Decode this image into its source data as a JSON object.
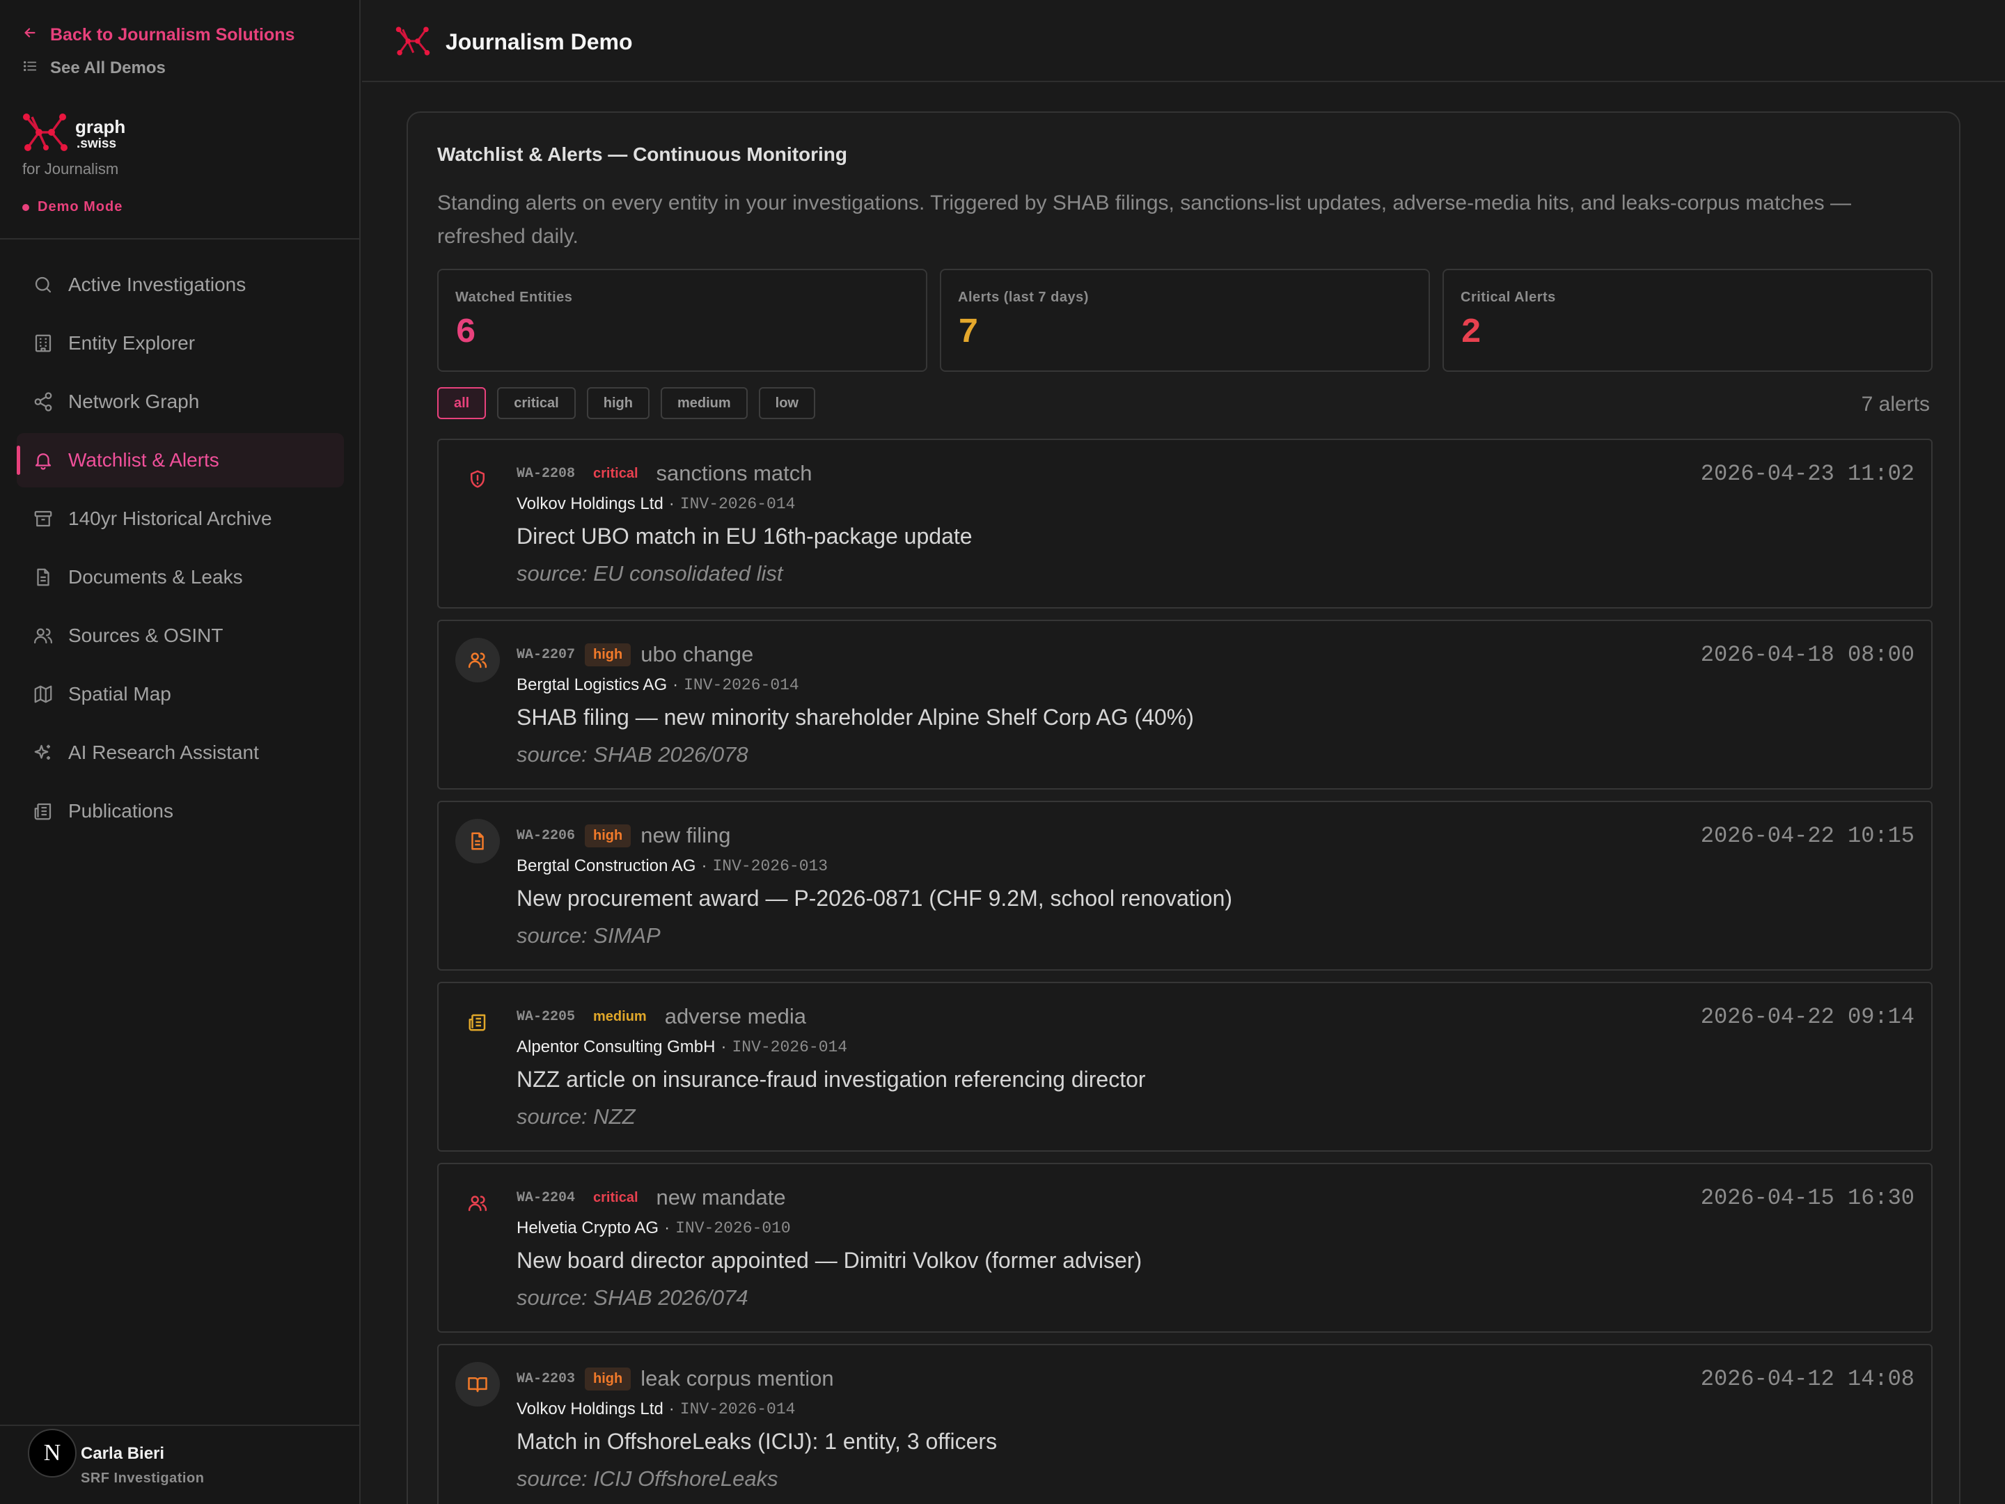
{
  "sidebar": {
    "back_label": "Back to Journalism Solutions",
    "see_all_label": "See All Demos",
    "brand_main": "graph",
    "brand_sub": ".swiss",
    "brand_for": "for Journalism",
    "demo_mode": "Demo Mode",
    "items": [
      {
        "label": "Active Investigations",
        "icon": "search-icon"
      },
      {
        "label": "Entity Explorer",
        "icon": "building-icon"
      },
      {
        "label": "Network Graph",
        "icon": "share-nodes-icon"
      },
      {
        "label": "Watchlist & Alerts",
        "icon": "bell-icon",
        "active": true
      },
      {
        "label": "140yr Historical Archive",
        "icon": "archive-box-icon"
      },
      {
        "label": "Documents & Leaks",
        "icon": "document-icon"
      },
      {
        "label": "Sources & OSINT",
        "icon": "users-icon"
      },
      {
        "label": "Spatial Map",
        "icon": "map-icon"
      },
      {
        "label": "AI Research Assistant",
        "icon": "sparkles-icon"
      },
      {
        "label": "Publications",
        "icon": "newspaper-icon"
      }
    ],
    "user": {
      "avatar_letter": "N",
      "name": "Carla Bieri",
      "org": "SRF Investigation"
    }
  },
  "header": {
    "title": "Journalism Demo"
  },
  "panel": {
    "title": "Watchlist & Alerts — Continuous Monitoring",
    "description": "Standing alerts on every entity in your investigations. Triggered by SHAB filings, sanctions-list updates, adverse-media hits, and leaks-corpus matches — refreshed daily.",
    "stats": [
      {
        "label": "Watched Entities",
        "value": "6",
        "color": "#e8417c"
      },
      {
        "label": "Alerts (last 7 days)",
        "value": "7",
        "color": "#e5a82c"
      },
      {
        "label": "Critical Alerts",
        "value": "2",
        "color": "#e8414f"
      }
    ],
    "filters": [
      "all",
      "critical",
      "high",
      "medium",
      "low"
    ],
    "active_filter": "all",
    "alert_count": "7 alerts",
    "alerts": [
      {
        "id": "WA-2208",
        "severity": "critical",
        "type": "sanctions match",
        "time": "2026-04-23 11:02",
        "entity": "Volkov Holdings Ltd",
        "inv": "INV-2026-014",
        "message": "Direct UBO match in EU 16th-package update",
        "source": "source: EU consolidated list",
        "icon": "shield-alert-icon"
      },
      {
        "id": "WA-2207",
        "severity": "high",
        "type": "ubo change",
        "time": "2026-04-18 08:00",
        "entity": "Bergtal Logistics AG",
        "inv": "INV-2026-014",
        "message": "SHAB filing — new minority shareholder Alpine Shelf Corp AG (40%)",
        "source": "source: SHAB 2026/078",
        "icon": "users-icon"
      },
      {
        "id": "WA-2206",
        "severity": "high",
        "type": "new filing",
        "time": "2026-04-22 10:15",
        "entity": "Bergtal Construction AG",
        "inv": "INV-2026-013",
        "message": "New procurement award — P-2026-0871 (CHF 9.2M, school renovation)",
        "source": "source: SIMAP",
        "icon": "document-icon"
      },
      {
        "id": "WA-2205",
        "severity": "medium",
        "type": "adverse media",
        "time": "2026-04-22 09:14",
        "entity": "Alpentor Consulting GmbH",
        "inv": "INV-2026-014",
        "message": "NZZ article on insurance-fraud investigation referencing director",
        "source": "source: NZZ",
        "icon": "newspaper-icon"
      },
      {
        "id": "WA-2204",
        "severity": "critical",
        "type": "new mandate",
        "time": "2026-04-15 16:30",
        "entity": "Helvetia Crypto AG",
        "inv": "INV-2026-010",
        "message": "New board director appointed — Dimitri Volkov (former adviser)",
        "source": "source: SHAB 2026/074",
        "icon": "users-icon"
      },
      {
        "id": "WA-2203",
        "severity": "high",
        "type": "leak corpus mention",
        "time": "2026-04-12 14:08",
        "entity": "Volkov Holdings Ltd",
        "inv": "INV-2026-014",
        "message": "Match in OffshoreLeaks (ICIJ): 1 entity, 3 officers",
        "source": "source: ICIJ OffshoreLeaks",
        "icon": "book-open-icon"
      }
    ]
  }
}
